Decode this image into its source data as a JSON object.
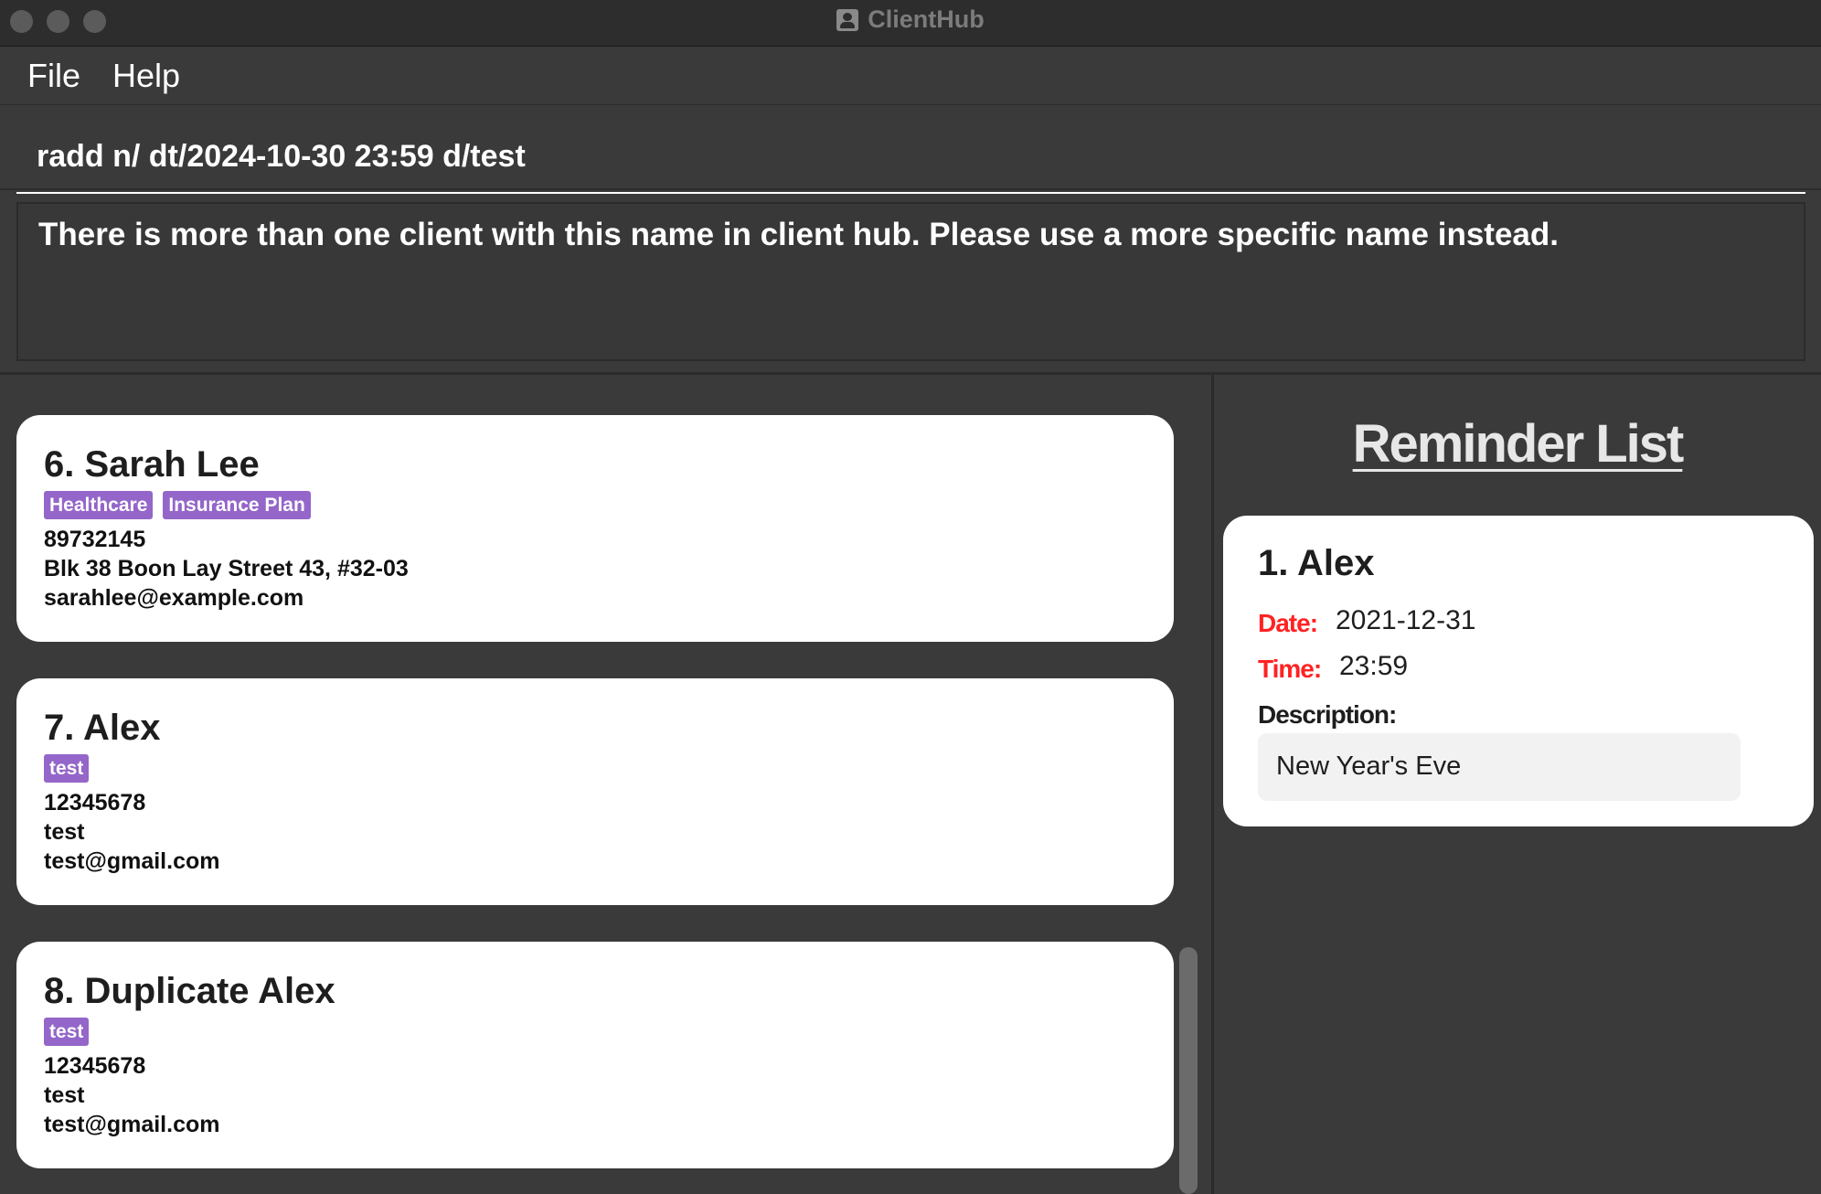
{
  "window": {
    "title": "ClientHub"
  },
  "menu": {
    "items": [
      "File",
      "Help"
    ]
  },
  "command": {
    "value": "radd n/ dt/2024-10-30 23:59 d/test"
  },
  "result": {
    "message": "There is more than one client with this name in client hub. Please use a more specific name instead."
  },
  "clients": [
    {
      "name": "6. Sarah Lee",
      "tags": [
        "Healthcare",
        "Insurance Plan"
      ],
      "phone": "89732145",
      "address": "Blk 38 Boon Lay Street 43, #32-03",
      "email": "sarahlee@example.com"
    },
    {
      "name": "7. Alex",
      "tags": [
        "test"
      ],
      "phone": "12345678",
      "address": "test",
      "email": "test@gmail.com"
    },
    {
      "name": "8. Duplicate Alex",
      "tags": [
        "test"
      ],
      "phone": "12345678",
      "address": "test",
      "email": "test@gmail.com"
    }
  ],
  "reminders": {
    "title": "Reminder List",
    "items": [
      {
        "name": "1.  Alex",
        "date_label": "Date:",
        "date": "2021-12-31",
        "time_label": "Time:",
        "time": "23:59",
        "description_label": "Description:",
        "description": "New Year's Eve"
      }
    ]
  },
  "colors": {
    "background": "#3a3a3a",
    "tag": "#9466c9",
    "label_red": "#ff2222",
    "card": "#ffffff"
  }
}
